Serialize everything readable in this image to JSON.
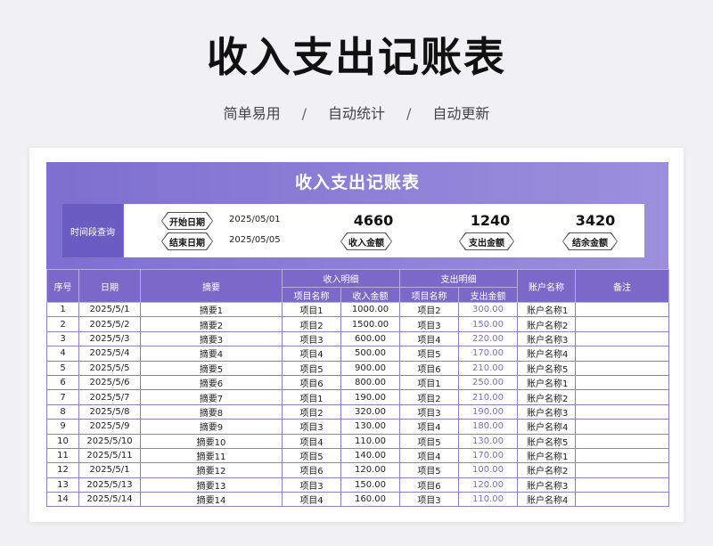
{
  "page": {
    "title": "收入支出记账表",
    "subtitle_items": [
      "简单易用",
      "自动统计",
      "自动更新"
    ],
    "separator": "/"
  },
  "sheet": {
    "banner_title": "收入支出记账表",
    "query": {
      "label": "时间段查询",
      "start_label": "开始日期",
      "start_value": "2025/05/01",
      "end_label": "结束日期",
      "end_value": "2025/05/05"
    },
    "summary": {
      "income": {
        "value": "4660",
        "label": "收入金额"
      },
      "expense": {
        "value": "1240",
        "label": "支出金额"
      },
      "balance": {
        "value": "3420",
        "label": "结余金额"
      }
    },
    "table": {
      "headers": {
        "index": "序号",
        "date": "日期",
        "summary": "摘要",
        "income_group": "收入明细",
        "expense_group": "支出明细",
        "item_name": "项目名称",
        "income_amount": "收入金额",
        "expense_amount": "支出金额",
        "account": "账户名称",
        "note": "备注"
      },
      "rows": [
        {
          "no": "1",
          "date": "2025/5/1",
          "summary": "摘要1",
          "in_item": "项目1",
          "in_amt": "1000.00",
          "out_item": "项目2",
          "out_amt": "300.00",
          "account": "账户名称1",
          "note": ""
        },
        {
          "no": "2",
          "date": "2025/5/2",
          "summary": "摘要2",
          "in_item": "项目2",
          "in_amt": "1500.00",
          "out_item": "项目3",
          "out_amt": "150.00",
          "account": "账户名称2",
          "note": ""
        },
        {
          "no": "3",
          "date": "2025/5/3",
          "summary": "摘要3",
          "in_item": "项目3",
          "in_amt": "600.00",
          "out_item": "项目4",
          "out_amt": "220.00",
          "account": "账户名称3",
          "note": ""
        },
        {
          "no": "4",
          "date": "2025/5/4",
          "summary": "摘要4",
          "in_item": "项目4",
          "in_amt": "500.00",
          "out_item": "项目5",
          "out_amt": "170.00",
          "account": "账户名称4",
          "note": ""
        },
        {
          "no": "5",
          "date": "2025/5/5",
          "summary": "摘要5",
          "in_item": "项目5",
          "in_amt": "900.00",
          "out_item": "项目6",
          "out_amt": "210.00",
          "account": "账户名称5",
          "note": ""
        },
        {
          "no": "6",
          "date": "2025/5/6",
          "summary": "摘要6",
          "in_item": "项目6",
          "in_amt": "800.00",
          "out_item": "项目1",
          "out_amt": "250.00",
          "account": "账户名称1",
          "note": ""
        },
        {
          "no": "7",
          "date": "2025/5/7",
          "summary": "摘要7",
          "in_item": "项目1",
          "in_amt": "190.00",
          "out_item": "项目2",
          "out_amt": "210.00",
          "account": "账户名称2",
          "note": ""
        },
        {
          "no": "8",
          "date": "2025/5/8",
          "summary": "摘要8",
          "in_item": "项目2",
          "in_amt": "320.00",
          "out_item": "项目3",
          "out_amt": "190.00",
          "account": "账户名称3",
          "note": ""
        },
        {
          "no": "9",
          "date": "2025/5/9",
          "summary": "摘要9",
          "in_item": "项目3",
          "in_amt": "130.00",
          "out_item": "项目4",
          "out_amt": "180.00",
          "account": "账户名称4",
          "note": ""
        },
        {
          "no": "10",
          "date": "2025/5/10",
          "summary": "摘要10",
          "in_item": "项目4",
          "in_amt": "110.00",
          "out_item": "项目5",
          "out_amt": "130.00",
          "account": "账户名称5",
          "note": ""
        },
        {
          "no": "11",
          "date": "2025/5/11",
          "summary": "摘要11",
          "in_item": "项目5",
          "in_amt": "140.00",
          "out_item": "项目4",
          "out_amt": "170.00",
          "account": "账户名称1",
          "note": ""
        },
        {
          "no": "12",
          "date": "2025/5/1",
          "summary": "摘要12",
          "in_item": "项目6",
          "in_amt": "120.00",
          "out_item": "项目5",
          "out_amt": "100.00",
          "account": "账户名称2",
          "note": ""
        },
        {
          "no": "13",
          "date": "2025/5/13",
          "summary": "摘要13",
          "in_item": "项目3",
          "in_amt": "150.00",
          "out_item": "项目6",
          "out_amt": "120.00",
          "account": "账户名称3",
          "note": ""
        },
        {
          "no": "14",
          "date": "2025/5/14",
          "summary": "摘要14",
          "in_item": "项目4",
          "in_amt": "160.00",
          "out_item": "项目3",
          "out_amt": "110.00",
          "account": "账户名称4",
          "note": ""
        }
      ]
    }
  },
  "colors": {
    "banner": "#7e6fd0",
    "header": "#7b69c9",
    "query_label": "#6a5cc2",
    "expense_text": "#7b6fc6"
  }
}
